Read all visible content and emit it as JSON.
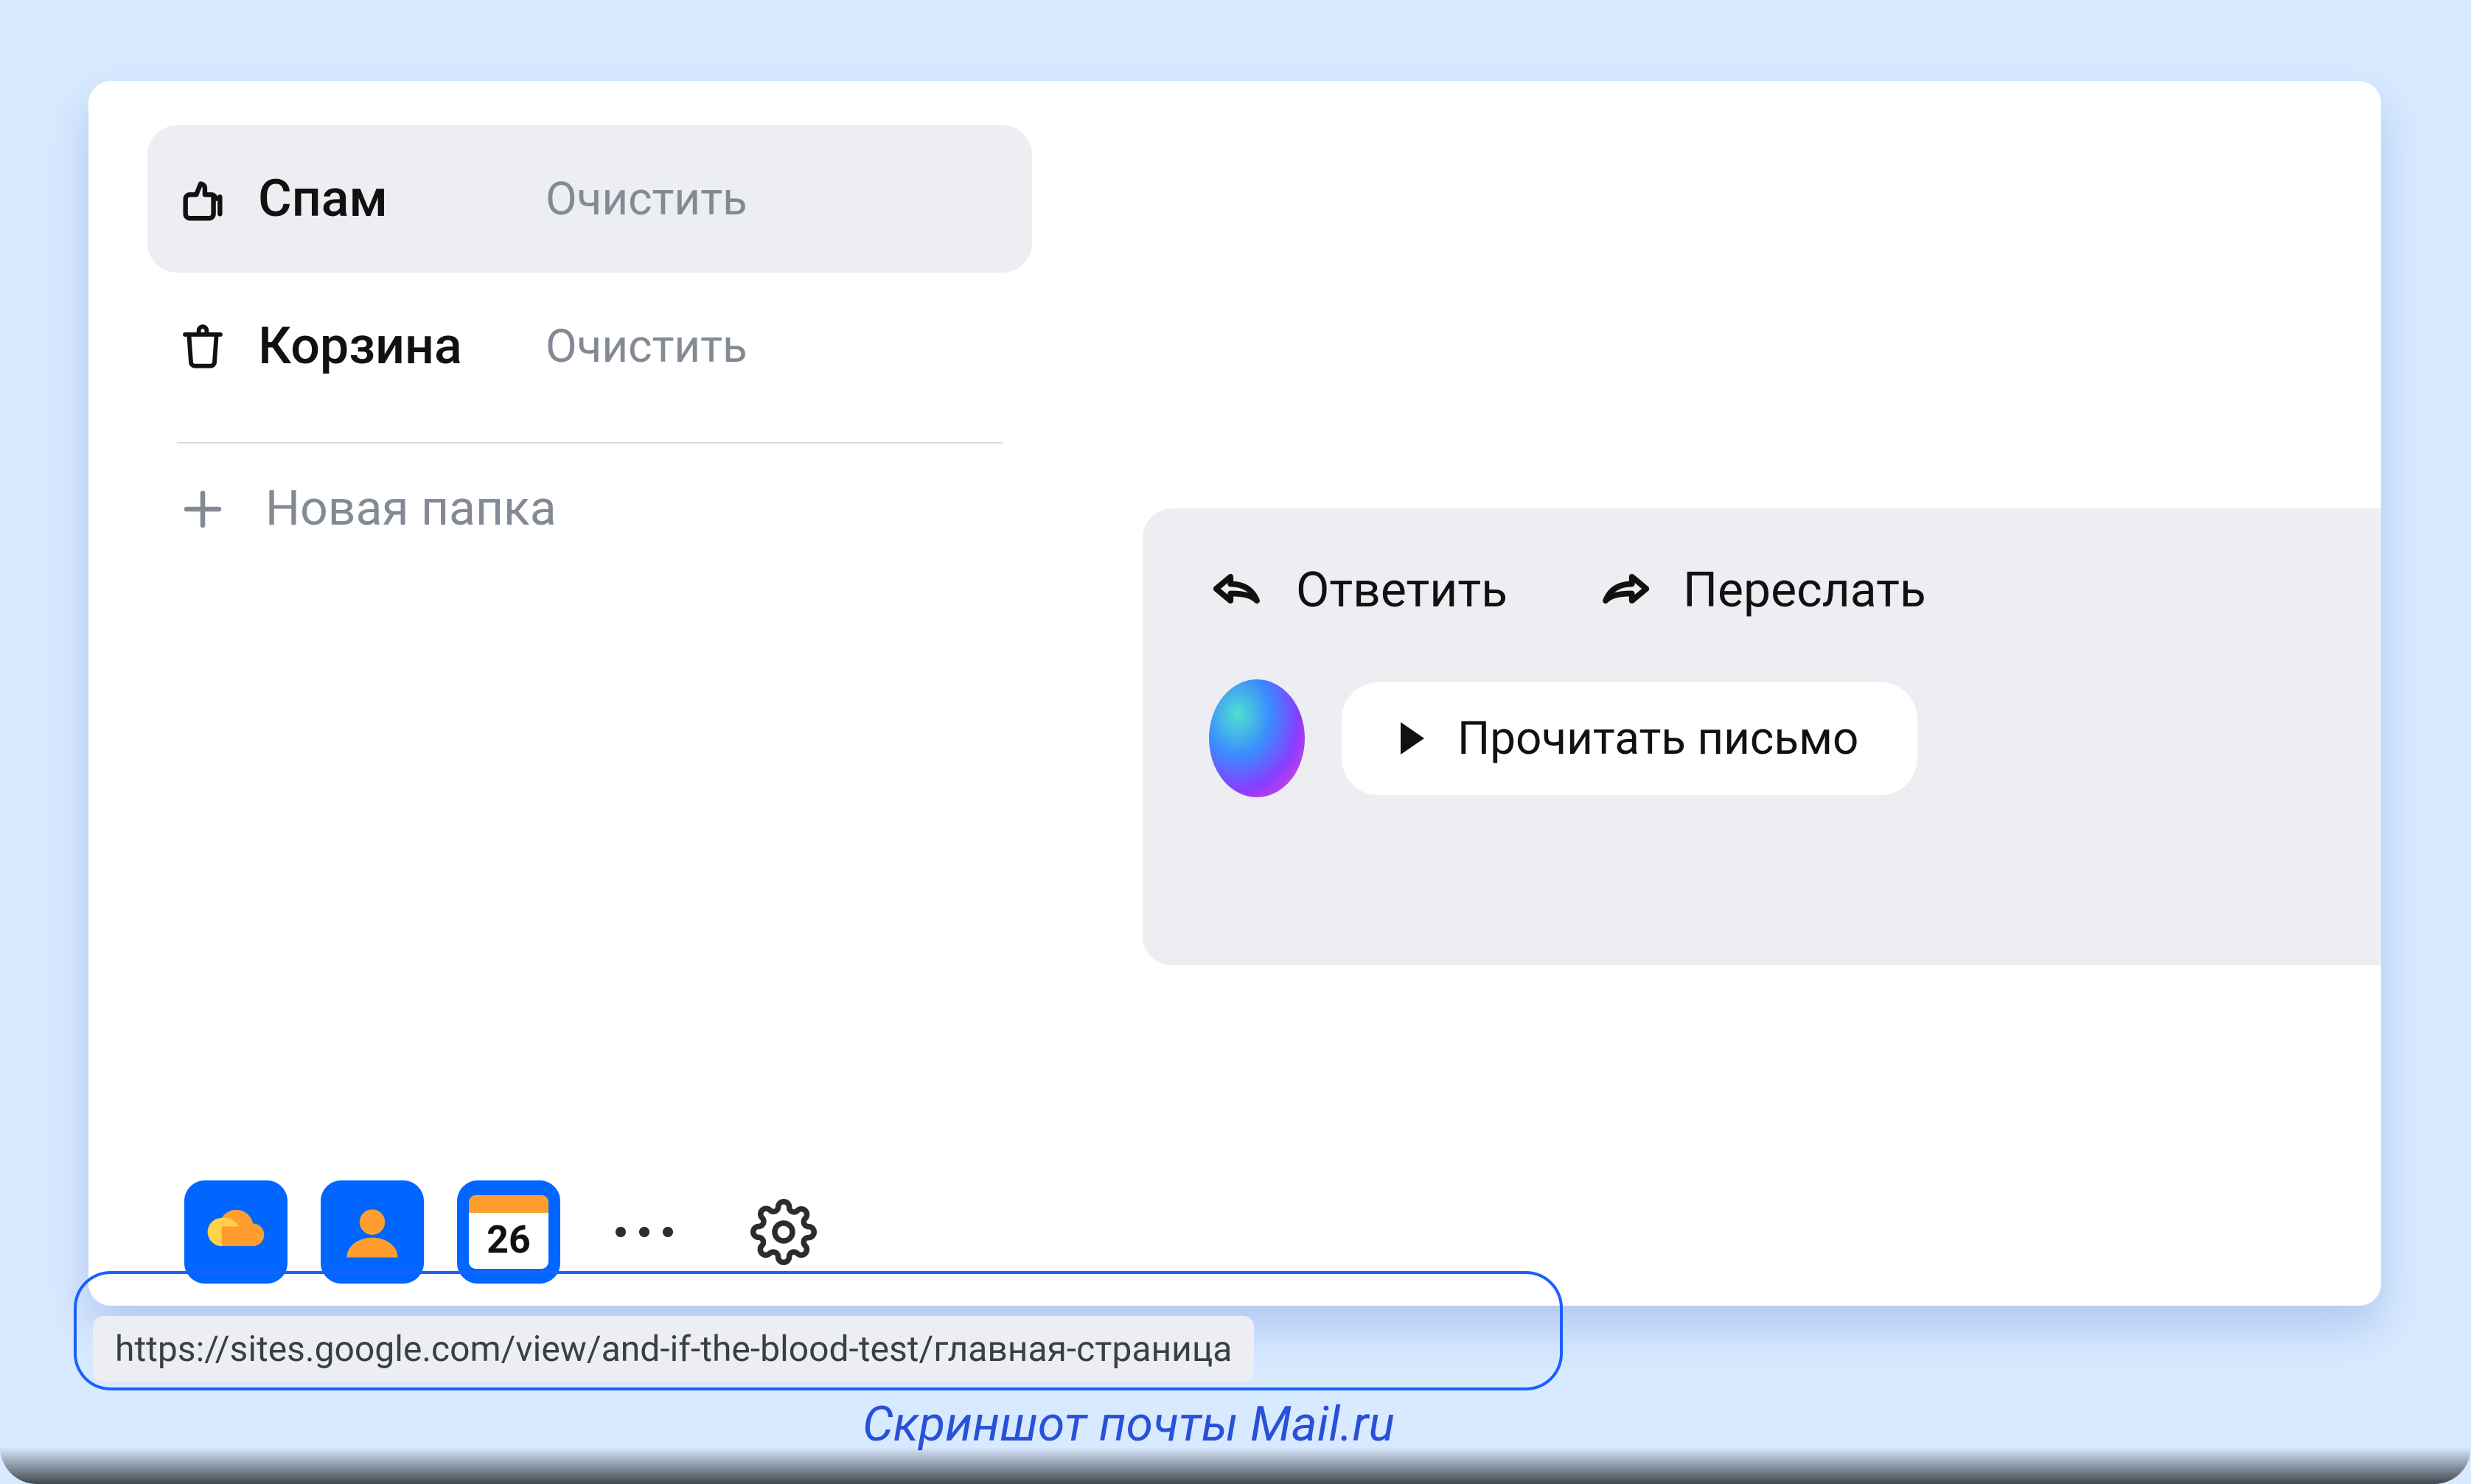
{
  "sidebar": {
    "folders": [
      {
        "name": "Спам",
        "action": "Очистить",
        "icon": "thumbs-down",
        "selected": true
      },
      {
        "name": "Корзина",
        "action": "Очистить",
        "icon": "trash",
        "selected": false
      }
    ],
    "new_folder_label": "Новая папка"
  },
  "actions": {
    "reply_label": "Ответить",
    "forward_label": "Переслать",
    "read_label": "Прочитать письмо"
  },
  "bottom": {
    "calendar_day": "26"
  },
  "annotation": {
    "url": "https://sites.google.com/view/and-if-the-blood-test/главная-страница"
  },
  "caption": "Скриншот почты Mail.ru"
}
